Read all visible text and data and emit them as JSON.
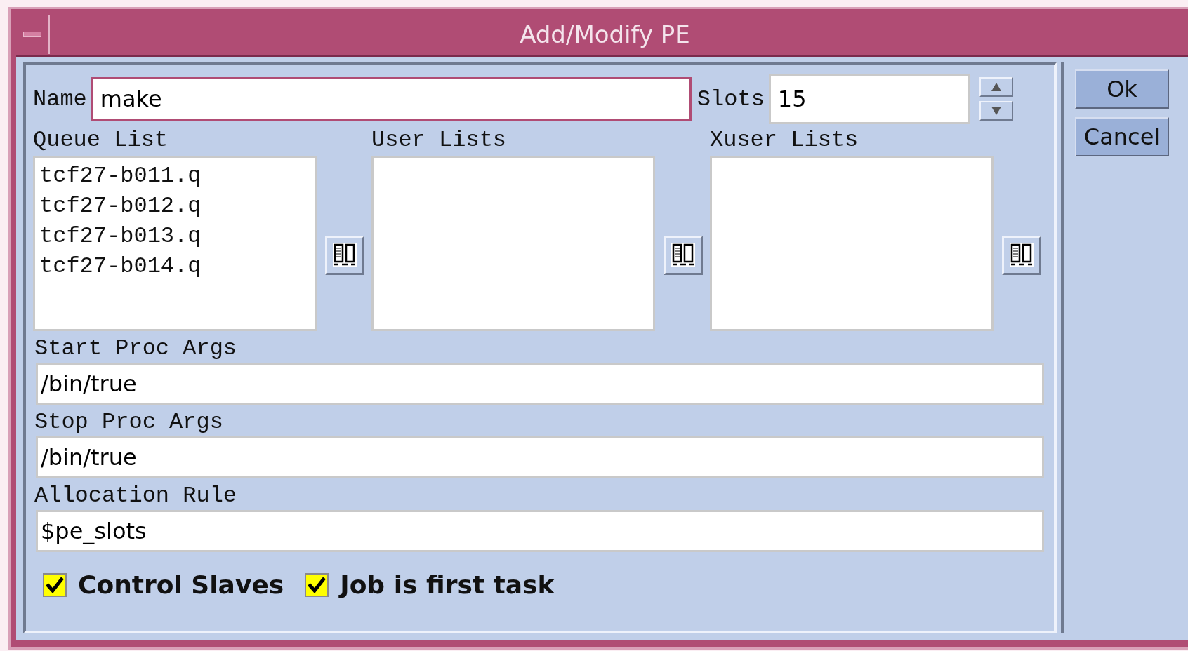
{
  "window": {
    "title": "Add/Modify PE"
  },
  "name_field": {
    "label": "Name",
    "value": "make"
  },
  "slots_field": {
    "label": "Slots",
    "value": "15"
  },
  "lists": [
    {
      "label": "Queue List",
      "items": [
        "tcf27-b011.q",
        "tcf27-b012.q",
        "tcf27-b013.q",
        "tcf27-b014.q"
      ]
    },
    {
      "label": "User Lists"
    },
    {
      "label": "Xuser Lists"
    }
  ],
  "text_fields": [
    {
      "label": "Start Proc Args",
      "value": "/bin/true"
    },
    {
      "label": "Stop Proc Args",
      "value": "/bin/true"
    },
    {
      "label": "Allocation Rule",
      "value": "$pe_slots"
    }
  ],
  "checkboxes": [
    {
      "label": "Control Slaves",
      "checked": true
    },
    {
      "label": "Job is first task",
      "checked": true
    }
  ],
  "buttons": [
    "Ok",
    "Cancel"
  ]
}
